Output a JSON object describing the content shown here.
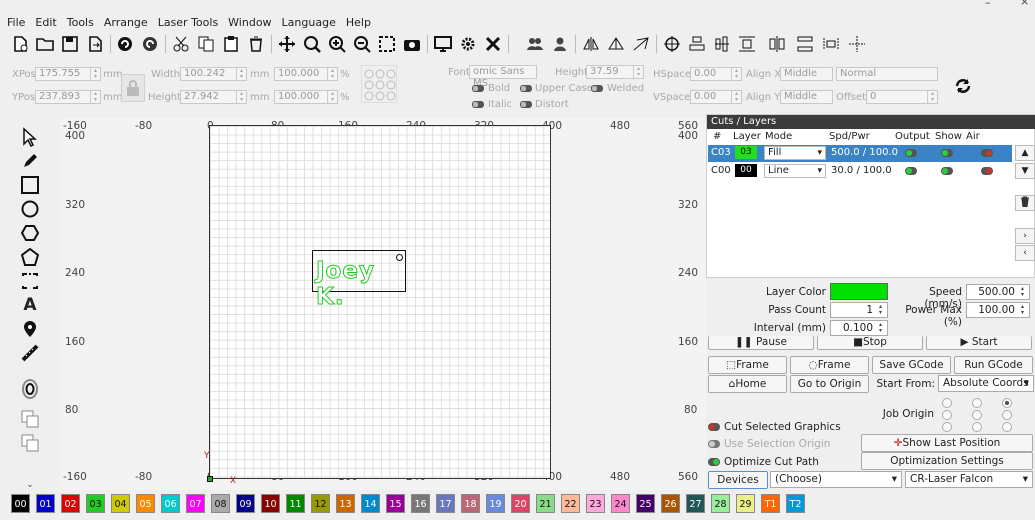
{
  "menu": [
    "File",
    "Edit",
    "Tools",
    "Arrange",
    "Laser Tools",
    "Window",
    "Language",
    "Help"
  ],
  "props": {
    "xpos_label": "XPos",
    "xpos": "175.755",
    "ypos_label": "YPos",
    "ypos": "237.893",
    "unit": "mm",
    "width_label": "Width",
    "width": "100.242",
    "height_label": "Height",
    "height": "27.942",
    "scale_w": "100.000",
    "scale_h": "100.000",
    "pct": "%",
    "font_label": "Font",
    "font": "omic Sans MS",
    "fheight_label": "Height",
    "fheight": "37.59",
    "bold": "Bold",
    "italic": "Italic",
    "upper": "Upper Case",
    "distort": "Distort",
    "welded": "Welded",
    "hspace_label": "HSpace",
    "hspace": "0.00",
    "vspace_label": "VSpace",
    "vspace": "0.00",
    "alignx_label": "Align X",
    "alignx": "Middle",
    "aligny_label": "Align Y",
    "aligny": "Middle",
    "style": "Normal",
    "offset_label": "Offset",
    "offset": "0"
  },
  "ruler": {
    "top": [
      "-160",
      "-80",
      "0",
      "80",
      "160",
      "240",
      "320",
      "400",
      "480",
      "560"
    ],
    "bottom": [
      "-160",
      "-80",
      "0",
      "80",
      "160",
      "240",
      "320",
      "400",
      "480",
      "560"
    ],
    "left": [
      "400",
      "320",
      "240",
      "160",
      "80"
    ],
    "right": [
      "400",
      "320",
      "240",
      "160",
      "80"
    ],
    "xaxis": "X",
    "yaxis": "Y"
  },
  "canvas_text": "Joey K.",
  "cuts": {
    "title": "Cuts / Layers",
    "headers": [
      "#",
      "Layer",
      "Mode",
      "Spd/Pwr",
      "Output",
      "Show",
      "Air"
    ],
    "rows": [
      {
        "num": "C03",
        "layer": "03",
        "mode": "Fill",
        "spdpwr": "500.0 / 100.0",
        "color": "#22dd22"
      },
      {
        "num": "C00",
        "layer": "00",
        "mode": "Line",
        "spdpwr": "30.0 / 100.0",
        "color": "#000000"
      }
    ]
  },
  "settings": {
    "layer_color": "Layer Color",
    "pass_count": "Pass Count",
    "pass_val": "1",
    "interval": "Interval (mm)",
    "interval_val": "0.100",
    "speed": "Speed (mm/s)",
    "speed_val": "500.00",
    "power": "Power Max (%)",
    "power_val": "100.00",
    "color": "#00e000"
  },
  "laser": {
    "pause": "Pause",
    "stop": "Stop",
    "start": "Start",
    "frame1": "Frame",
    "frame2": "Frame",
    "save": "Save GCode",
    "run": "Run GCode",
    "home": "Home",
    "goorigin": "Go to Origin",
    "startfrom": "Start From:",
    "startfrom_val": "Absolute Coords",
    "joborigin": "Job Origin",
    "cutsel": "Cut Selected Graphics",
    "usesel": "Use Selection Origin",
    "optcut": "Optimize Cut Path",
    "showlast": "Show Last Position",
    "optset": "Optimization Settings",
    "devices": "Devices",
    "port": "(Choose)",
    "device": "CR-Laser Falcon"
  },
  "palette": [
    {
      "l": "00",
      "c": "#000000"
    },
    {
      "l": "01",
      "c": "#0000cc"
    },
    {
      "l": "02",
      "c": "#dd0000"
    },
    {
      "l": "03",
      "c": "#22cc22"
    },
    {
      "l": "04",
      "c": "#cccc00"
    },
    {
      "l": "05",
      "c": "#ff8800"
    },
    {
      "l": "06",
      "c": "#00cccc"
    },
    {
      "l": "07",
      "c": "#ff00ff"
    },
    {
      "l": "08",
      "c": "#aaaaaa"
    },
    {
      "l": "09",
      "c": "#000088"
    },
    {
      "l": "10",
      "c": "#880000"
    },
    {
      "l": "11",
      "c": "#008800"
    },
    {
      "l": "12",
      "c": "#999900"
    },
    {
      "l": "13",
      "c": "#cc6600"
    },
    {
      "l": "14",
      "c": "#0088cc"
    },
    {
      "l": "15",
      "c": "#990099"
    },
    {
      "l": "16",
      "c": "#777777"
    },
    {
      "l": "17",
      "c": "#6677bb"
    },
    {
      "l": "18",
      "c": "#bb6677"
    },
    {
      "l": "19",
      "c": "#6688dd"
    },
    {
      "l": "20",
      "c": "#dd4466"
    },
    {
      "l": "21",
      "c": "#88dd88"
    },
    {
      "l": "22",
      "c": "#ffbb99"
    },
    {
      "l": "23",
      "c": "#ffaadd"
    },
    {
      "l": "24",
      "c": "#ff88cc"
    },
    {
      "l": "25",
      "c": "#440066"
    },
    {
      "l": "26",
      "c": "#aa5500"
    },
    {
      "l": "27",
      "c": "#225555"
    },
    {
      "l": "28",
      "c": "#99ee99"
    },
    {
      "l": "29",
      "c": "#eeee88"
    },
    {
      "l": "T1",
      "c": "#ff6600"
    },
    {
      "l": "T2",
      "c": "#0099dd"
    }
  ]
}
